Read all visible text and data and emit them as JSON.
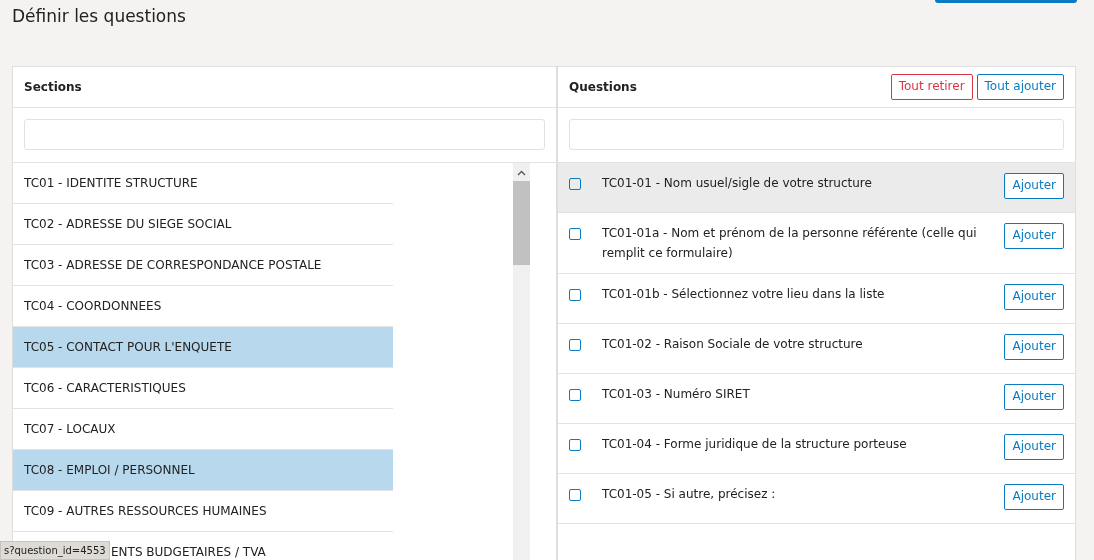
{
  "page_title": "Définir les questions",
  "sections": {
    "title": "Sections",
    "items": [
      {
        "label": "TC01 - IDENTITE STRUCTURE",
        "selected": false
      },
      {
        "label": "TC02 - ADRESSE DU SIEGE SOCIAL",
        "selected": false
      },
      {
        "label": "TC03 - ADRESSE DE CORRESPONDANCE POSTALE",
        "selected": false
      },
      {
        "label": "TC04 - COORDONNEES",
        "selected": false
      },
      {
        "label": "TC05 - CONTACT POUR L'ENQUETE",
        "selected": true
      },
      {
        "label": "TC06 - CARACTERISTIQUES",
        "selected": false
      },
      {
        "label": "TC07 - LOCAUX",
        "selected": false
      },
      {
        "label": "TC08 - EMPLOI / PERSONNEL",
        "selected": true
      },
      {
        "label": "TC09 - AUTRES RESSOURCES HUMAINES",
        "selected": false
      },
      {
        "label": "ENTS BUDGETAIRES / TVA",
        "selected": false,
        "kind": "covered"
      }
    ]
  },
  "questions": {
    "title": "Questions",
    "remove_all": "Tout retirer",
    "add_all": "Tout ajouter",
    "items": [
      {
        "label": "TC01-01 - Nom usuel/sigle de votre structure",
        "checked": false,
        "highlighted": true,
        "button": "Ajouter"
      },
      {
        "label": "TC01-01a - Nom et prénom de la personne référente (celle qui remplit ce formulaire)",
        "checked": false,
        "highlighted": false,
        "button": "Ajouter"
      },
      {
        "label": "TC01-01b - Sélectionnez votre lieu dans la liste",
        "checked": false,
        "highlighted": false,
        "button": "Ajouter"
      },
      {
        "label": "TC01-02 - Raison Sociale de votre structure",
        "checked": false,
        "highlighted": false,
        "button": "Ajouter"
      },
      {
        "label": "TC01-03 - Numéro SIRET",
        "checked": false,
        "highlighted": false,
        "button": "Ajouter"
      },
      {
        "label": "TC01-04 - Forme juridique de la structure porteuse",
        "checked": false,
        "highlighted": false,
        "button": "Ajouter"
      },
      {
        "label": "TC01-05 - Si autre, précisez :",
        "checked": false,
        "highlighted": false,
        "button": "Ajouter"
      }
    ]
  },
  "status_bar": "s?question_id=4553"
}
